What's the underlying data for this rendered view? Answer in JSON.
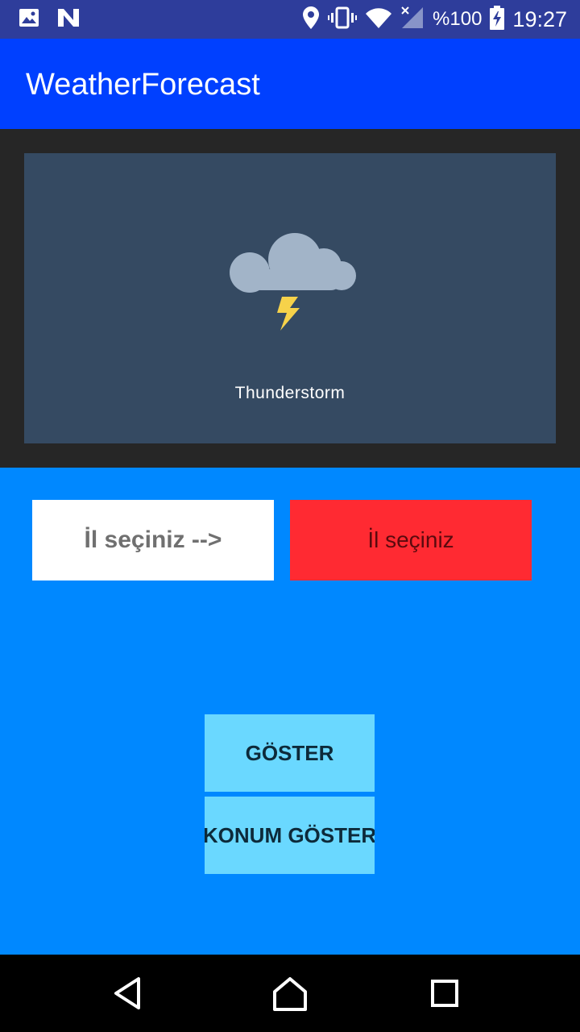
{
  "status_bar": {
    "battery_text": "%100",
    "time": "19:27",
    "icons": [
      "image-icon",
      "n-icon",
      "location-icon",
      "vibrate-icon",
      "wifi-icon",
      "signal-icon",
      "battery-charging-icon"
    ]
  },
  "app_bar": {
    "title": "WeatherForecast"
  },
  "weather": {
    "icon": "thunderstorm-icon",
    "description": "Thunderstorm"
  },
  "city": {
    "label": "İl seçiniz -->",
    "select_value": "İl seçiniz"
  },
  "buttons": {
    "show": "GÖSTER",
    "show_location": "KONUM GÖSTER"
  },
  "nav_bar": {
    "icons": [
      "back-icon",
      "home-icon",
      "recents-icon"
    ]
  },
  "colors": {
    "status_bar": "#2e3d9b",
    "app_bar": "#0040ff",
    "dark_section": "#262626",
    "weather_card": "#354a62",
    "blue_section": "#0088ff",
    "select_bg": "#ff2a32",
    "button_bg": "#6ad8ff"
  }
}
